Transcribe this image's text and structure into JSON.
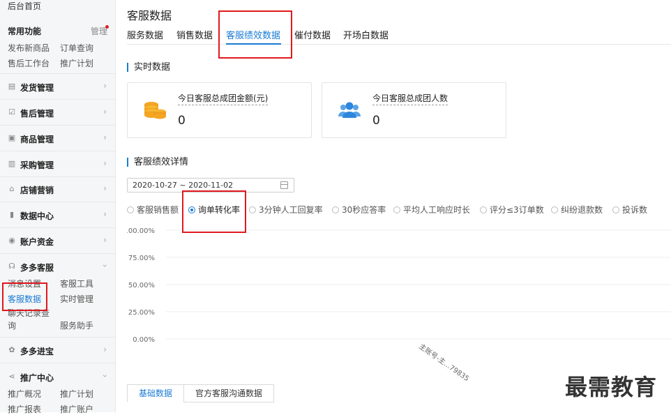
{
  "sidebar": {
    "home": "后台首页",
    "common_title": "常用功能",
    "manage": "管理",
    "common_links": [
      "发布新商品",
      "订单查询",
      "售后工作台",
      "推广计划"
    ],
    "menus": [
      {
        "label": "发货管理",
        "icon": "shipping-icon"
      },
      {
        "label": "售后管理",
        "icon": "after-sale-icon"
      },
      {
        "label": "商品管理",
        "icon": "goods-icon"
      },
      {
        "label": "采购管理",
        "icon": "purchase-icon"
      },
      {
        "label": "店铺营销",
        "icon": "store-icon"
      },
      {
        "label": "数据中心",
        "icon": "data-icon"
      },
      {
        "label": "账户资金",
        "icon": "account-icon"
      }
    ],
    "cs_section": {
      "label": "多多客服",
      "links": [
        "消息设置",
        "客服工具",
        "客服数据",
        "实时管理",
        "聊天记录查询",
        "服务助手"
      ]
    },
    "jinbao": "多多进宝",
    "promo_section": {
      "label": "推广中心",
      "links": [
        "推广概况",
        "推广计划",
        "推广报表",
        "推广账户"
      ]
    }
  },
  "page": {
    "title": "客服数据",
    "tabs": [
      "服务数据",
      "销售数据",
      "客服绩效数据",
      "催付数据",
      "开场白数据"
    ],
    "active_tab": "客服绩效数据"
  },
  "realtime": {
    "section_title": "实时数据",
    "cards": [
      {
        "title": "今日客服总成团金额(元)",
        "value": "0",
        "icon": "coins-icon"
      },
      {
        "title": "今日客服总成团人数",
        "value": "0",
        "icon": "users-icon"
      }
    ]
  },
  "detail": {
    "section_title": "客服绩效详情",
    "date_range": "2020-10-27 ~ 2020-11-02",
    "metrics": [
      "客服销售额",
      "询单转化率",
      "3分钟人工回复率",
      "30秒应答率",
      "平均人工响应时长",
      "评分≤3订单数",
      "纠纷退款数",
      "投诉数"
    ],
    "selected_metric": "询单转化率"
  },
  "chart_data": {
    "type": "bar",
    "categories": [
      "主账号-主...79835"
    ],
    "values": [
      0
    ],
    "yticks": [
      "100.00%",
      "75.00%",
      "50.00%",
      "25.00%",
      "0.00%"
    ],
    "ylim": [
      0,
      100
    ],
    "grid": true
  },
  "bottom_tabs": [
    "基础数据",
    "官方客服沟通数据"
  ],
  "watermark": "最需教育",
  "colors": {
    "accent": "#1a7bd4",
    "annotation": "#e0181e"
  }
}
